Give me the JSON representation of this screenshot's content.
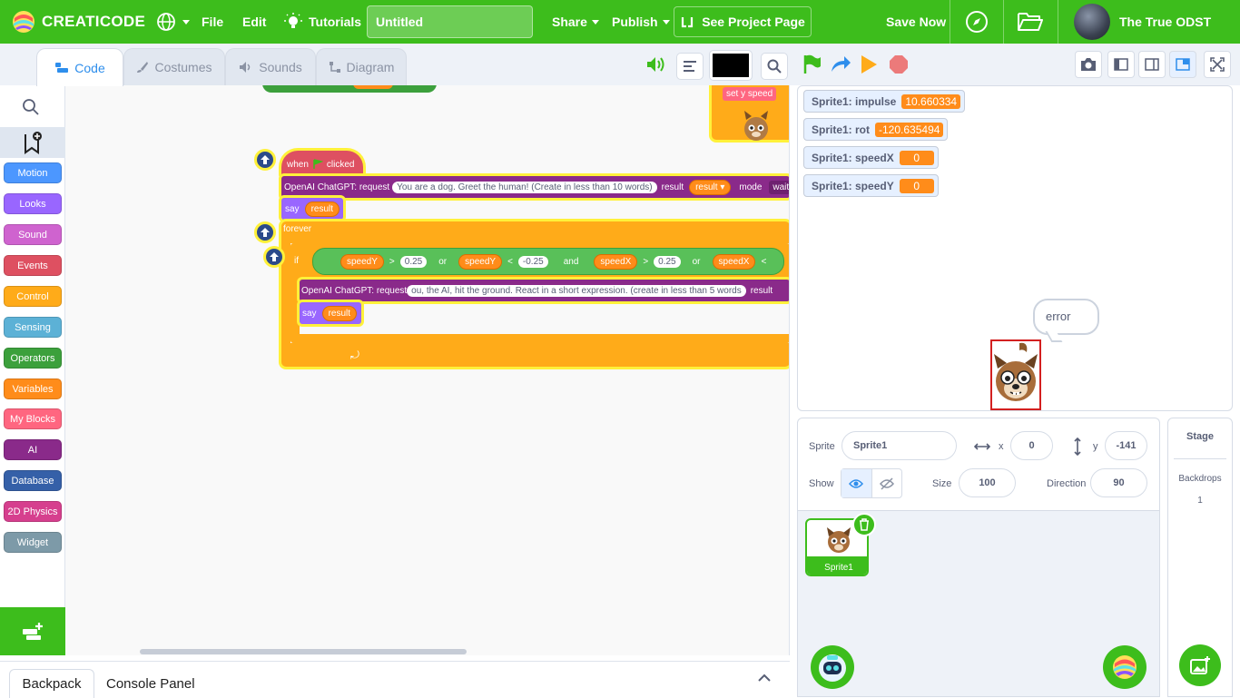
{
  "header": {
    "brand": "CREATICODE",
    "file_label": "File",
    "edit_label": "Edit",
    "tutorials_label": "Tutorials",
    "project_title": "Untitled",
    "share_label": "Share",
    "publish_label": "Publish",
    "see_project_label": "See Project Page",
    "save_now_label": "Save Now",
    "username": "The True ODST",
    "bg_color": "#3dbd1c"
  },
  "editor_tabs": [
    {
      "label": "Code",
      "icon": "code-icon"
    },
    {
      "label": "Costumes",
      "icon": "brush-icon"
    },
    {
      "label": "Sounds",
      "icon": "speaker-icon"
    },
    {
      "label": "Diagram",
      "icon": "diagram-icon"
    }
  ],
  "categories": [
    {
      "label": "Motion",
      "color": "#4c97ff"
    },
    {
      "label": "Looks",
      "color": "#9966ff"
    },
    {
      "label": "Sound",
      "color": "#cf63cf"
    },
    {
      "label": "Events",
      "color": "#de5061"
    },
    {
      "label": "Control",
      "color": "#ffab19"
    },
    {
      "label": "Sensing",
      "color": "#5cb1d6"
    },
    {
      "label": "Operators",
      "color": "#3ca03c"
    },
    {
      "label": "Variables",
      "color": "#ff8c1a"
    },
    {
      "label": "My Blocks",
      "color": "#ff6680"
    },
    {
      "label": "AI",
      "color": "#8a2a8a"
    },
    {
      "label": "Database",
      "color": "#3560a8"
    },
    {
      "label": "2D Physics",
      "color": "#d63f8e"
    },
    {
      "label": "Widget",
      "color": "#7d9aa8"
    }
  ],
  "script": {
    "top_fragment": "set y speed",
    "hat_when": "when",
    "hat_clicked": "clicked",
    "chatgpt1_label": "OpenAI ChatGPT: request",
    "chatgpt1_prompt": "You are a dog. Greet the human! (Create in less than 10 words)",
    "result_label": "result",
    "result_dropdown": "result",
    "mode_label": "mode",
    "mode_value": "waiti",
    "say_label": "say",
    "say_value": "result",
    "forever_label": "forever",
    "if_label": "if",
    "cond": [
      {
        "var": "speedY",
        "op": ">",
        "val": "0.25"
      },
      {
        "join": "or"
      },
      {
        "var": "speedY",
        "op": "<",
        "val": "-0.25"
      },
      {
        "join": "and"
      },
      {
        "var": "speedX",
        "op": ">",
        "val": "0.25"
      },
      {
        "join": "or"
      },
      {
        "var": "speedX",
        "op": "<",
        "val": ""
      }
    ],
    "chatgpt2_label": "OpenAI ChatGPT: request",
    "chatgpt2_prompt": "ou, the AI, hit the ground. React in a short expression. (create in less than 5 words",
    "chatgpt2_result_label": "result",
    "say2_label": "say",
    "say2_value": "result"
  },
  "bottom": {
    "backpack_label": "Backpack",
    "console_label": "Console Panel"
  },
  "monitors": [
    {
      "label": "Sprite1: impulse",
      "value": "10.660334"
    },
    {
      "label": "Sprite1: rot",
      "value": "-120.635494"
    },
    {
      "label": "Sprite1: speedX",
      "value": "0"
    },
    {
      "label": "Sprite1: speedY",
      "value": "0"
    }
  ],
  "stage": {
    "speech": "error"
  },
  "sprite_info": {
    "sprite_label": "Sprite",
    "sprite_name": "Sprite1",
    "x_label": "x",
    "x_value": "0",
    "y_label": "y",
    "y_value": "-141",
    "show_label": "Show",
    "size_label": "Size",
    "size_value": "100",
    "direction_label": "Direction",
    "direction_value": "90"
  },
  "sprite_list": [
    {
      "name": "Sprite1",
      "selected": true
    }
  ],
  "stage_pane": {
    "title": "Stage",
    "backdrops_label": "Backdrops",
    "backdrops_count": "1"
  }
}
